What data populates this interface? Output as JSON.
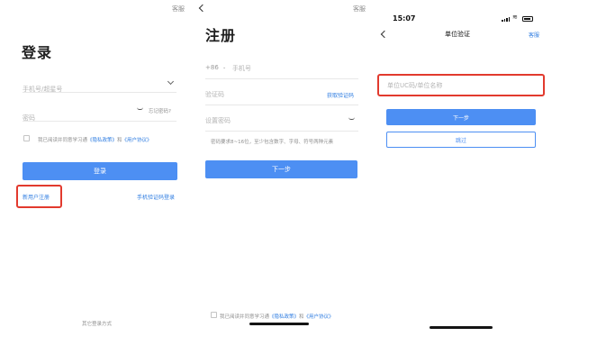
{
  "login": {
    "top_link": "客服",
    "title": "登录",
    "phone_placeholder": "手机号/超星号",
    "password_placeholder": "密码",
    "forgot_password": "忘记密码?",
    "agreement_prefix": "我已阅读并同意学习通",
    "privacy_policy": "《隐私政策》",
    "agreement_and": "和",
    "user_agreement": "《用户协议》",
    "login_button": "登录",
    "register_link": "新用户注册",
    "sms_login_link": "手机验证码登录",
    "other_login": "其它登录方式"
  },
  "register": {
    "top_link": "客服",
    "title": "注册",
    "country_code": "+86",
    "phone_placeholder": "手机号",
    "code_placeholder": "验证码",
    "get_code": "获取验证码",
    "password_placeholder": "设置密码",
    "password_hint": "密码要求8~16位，至少包含数字、字母、符号两种元素",
    "next_button": "下一步",
    "agreement_prefix": "我已阅读并同意学习通",
    "privacy_policy": "《隐私政策》",
    "agreement_and": "和",
    "user_agreement": "《用户协议》"
  },
  "unit_verify": {
    "status_time": "15:07",
    "nav_title": "单位验证",
    "nav_right": "客服",
    "input_placeholder": "单位UC码/单位名称",
    "next_button": "下一步",
    "skip_button": "跳过"
  },
  "colors": {
    "primary": "#4d8ff3",
    "link": "#2f7de1",
    "highlight": "#e23a2e"
  }
}
